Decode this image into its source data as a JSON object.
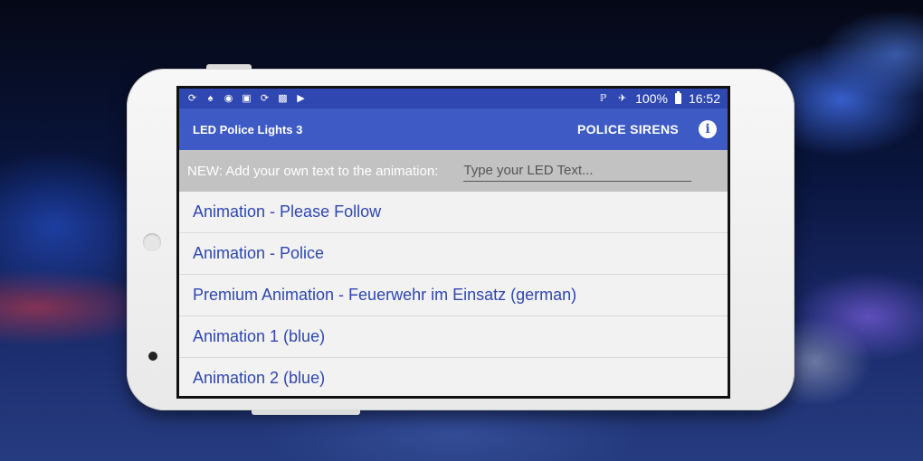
{
  "status_bar": {
    "left_icons": [
      "sync-icon",
      "key-icon",
      "location-icon",
      "image-icon",
      "sync-icon",
      "gallery-icon",
      "play-store-icon"
    ],
    "battery": "100%",
    "time": "16:52"
  },
  "app_bar": {
    "title": "LED Police Lights 3",
    "action_label": "POLICE SIRENS",
    "info_icon": "i"
  },
  "led_text": {
    "label": "NEW: Add your own text to the animation:",
    "placeholder": "Type your LED Text...",
    "value": ""
  },
  "animations": [
    {
      "label": "Animation - Please Follow"
    },
    {
      "label": "Animation - Police"
    },
    {
      "label": "Premium Animation - Feuerwehr im Einsatz (german)"
    },
    {
      "label": "Animation 1 (blue)"
    },
    {
      "label": "Animation 2 (blue)"
    }
  ],
  "colors": {
    "status_bar": "#2f47b0",
    "app_bar": "#3e5ac4",
    "list_text": "#2f47b0",
    "input_row": "#c2c2c2"
  }
}
